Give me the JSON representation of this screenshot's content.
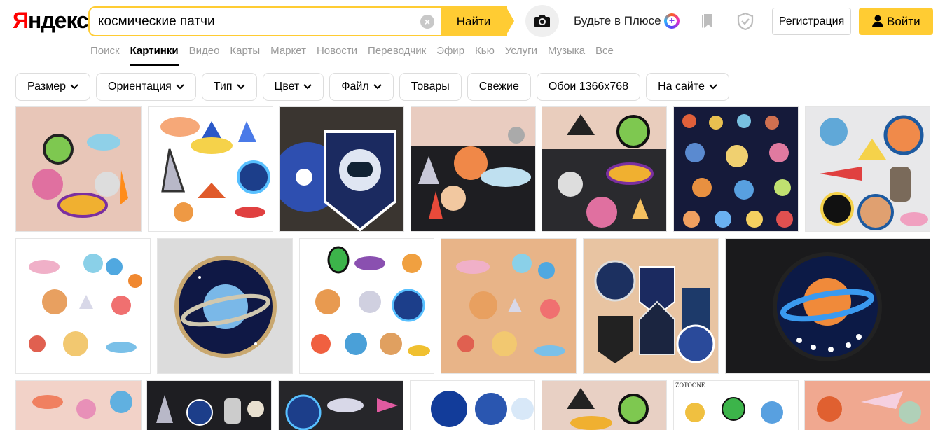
{
  "logo": {
    "y": "Я",
    "rest": "ндекс"
  },
  "search": {
    "query": "космические патчи",
    "clear": "×",
    "button": "Найти"
  },
  "header": {
    "plus_text": "Будьте в Плюсе",
    "register": "Регистрация",
    "login": "Войти"
  },
  "nav": [
    "Поиск",
    "Картинки",
    "Видео",
    "Карты",
    "Маркет",
    "Новости",
    "Переводчик",
    "Эфир",
    "Кью",
    "Услуги",
    "Музыка",
    "Все"
  ],
  "filters": [
    "Размер",
    "Ориентация",
    "Тип",
    "Цвет",
    "Файл",
    "Товары",
    "Свежие",
    "Обои 1366x768",
    "На сайте"
  ],
  "watermark": "ZOTOONE",
  "colors": {
    "accent": "#ffcc33",
    "logo_red": "#ff0000",
    "nav_inactive": "#999999"
  }
}
